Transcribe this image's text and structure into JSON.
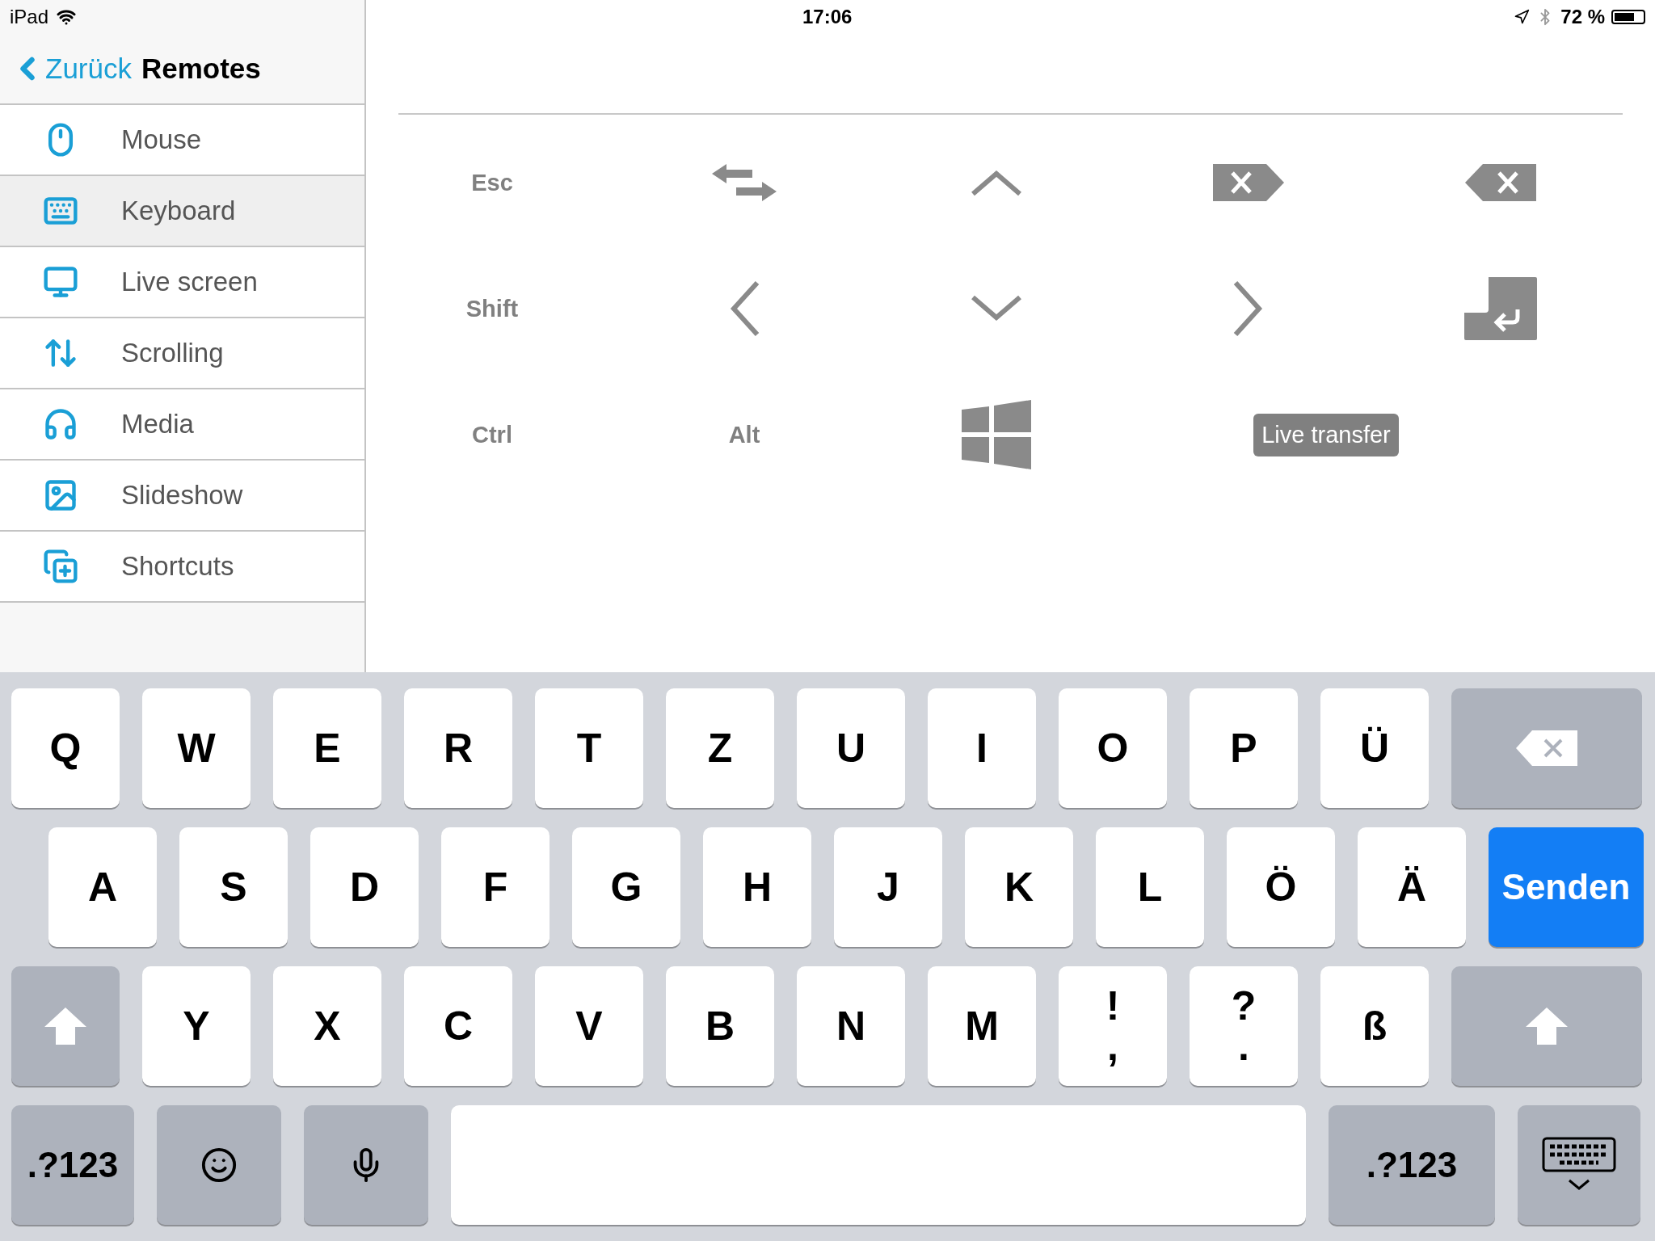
{
  "status_bar": {
    "device": "iPad",
    "time": "17:06",
    "battery": "72 %"
  },
  "nav": {
    "back": "Zurück",
    "title": "Remotes"
  },
  "sidebar": {
    "items": [
      {
        "label": "Mouse",
        "kind": "mouse",
        "selected": false
      },
      {
        "label": "Keyboard",
        "kind": "keyboard",
        "selected": true
      },
      {
        "label": "Live screen",
        "kind": "screen",
        "selected": false
      },
      {
        "label": "Scrolling",
        "kind": "scrolling",
        "selected": false
      },
      {
        "label": "Media",
        "kind": "media",
        "selected": false
      },
      {
        "label": "Slideshow",
        "kind": "slideshow",
        "selected": false
      },
      {
        "label": "Shortcuts",
        "kind": "shortcuts",
        "selected": false
      }
    ]
  },
  "remote_keys": [
    {
      "kind": "text",
      "label": "Esc"
    },
    {
      "kind": "swap"
    },
    {
      "kind": "up"
    },
    {
      "kind": "delete"
    },
    {
      "kind": "backspace"
    },
    {
      "kind": "text",
      "label": "Shift"
    },
    {
      "kind": "left"
    },
    {
      "kind": "down"
    },
    {
      "kind": "right"
    },
    {
      "kind": "enter"
    },
    {
      "kind": "text",
      "label": "Ctrl"
    },
    {
      "kind": "text",
      "label": "Alt"
    },
    {
      "kind": "windows"
    },
    {
      "kind": "button",
      "label": "Live transfer"
    }
  ],
  "keyboard": {
    "key_rows": [
      {
        "keys": [
          {
            "kind": "letter",
            "label": "Q"
          },
          {
            "kind": "letter",
            "label": "W"
          },
          {
            "kind": "letter",
            "label": "E"
          },
          {
            "kind": "letter",
            "label": "R"
          },
          {
            "kind": "letter",
            "label": "T"
          },
          {
            "kind": "letter",
            "label": "Z"
          },
          {
            "kind": "letter",
            "label": "U"
          },
          {
            "kind": "letter",
            "label": "I"
          },
          {
            "kind": "letter",
            "label": "O"
          },
          {
            "kind": "letter",
            "label": "P"
          },
          {
            "kind": "letter",
            "label": "Ü"
          },
          {
            "kind": "backspace"
          }
        ]
      },
      {
        "keys": [
          {
            "kind": "letter",
            "label": "A"
          },
          {
            "kind": "letter",
            "label": "S"
          },
          {
            "kind": "letter",
            "label": "D"
          },
          {
            "kind": "letter",
            "label": "F"
          },
          {
            "kind": "letter",
            "label": "G"
          },
          {
            "kind": "letter",
            "label": "H"
          },
          {
            "kind": "letter",
            "label": "J"
          },
          {
            "kind": "letter",
            "label": "K"
          },
          {
            "kind": "letter",
            "label": "L"
          },
          {
            "kind": "letter",
            "label": "Ö"
          },
          {
            "kind": "letter",
            "label": "Ä"
          },
          {
            "kind": "return",
            "label": "Senden"
          }
        ]
      },
      {
        "keys": [
          {
            "kind": "shift"
          },
          {
            "kind": "letter",
            "label": "Y"
          },
          {
            "kind": "letter",
            "label": "X"
          },
          {
            "kind": "letter",
            "label": "C"
          },
          {
            "kind": "letter",
            "label": "V"
          },
          {
            "kind": "letter",
            "label": "B"
          },
          {
            "kind": "letter",
            "label": "N"
          },
          {
            "kind": "letter",
            "label": "M"
          },
          {
            "kind": "dual",
            "label": "!",
            "sub": ","
          },
          {
            "kind": "dual",
            "label": "?",
            "sub": "."
          },
          {
            "kind": "letter",
            "label": "ß"
          },
          {
            "kind": "shift"
          }
        ]
      },
      {
        "keys": [
          {
            "kind": "numbers",
            "label": ".?123"
          },
          {
            "kind": "emoji"
          },
          {
            "kind": "mic"
          },
          {
            "kind": "space"
          },
          {
            "kind": "numbers",
            "label": ".?123"
          },
          {
            "kind": "hide"
          }
        ]
      }
    ]
  }
}
